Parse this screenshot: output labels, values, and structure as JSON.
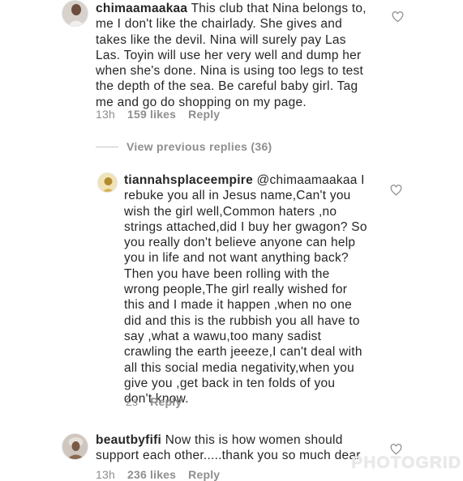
{
  "comments": [
    {
      "username": "chimaamaakaa",
      "text": "This club that Nina belongs to,\nme I don't like the chairlady. She gives and\ntakes like the devil. Nina will surely pay Las\nLas. Toyin will use her very well and dump her\nwhen she's done. Nina is using too legs to test\nthe depth of the sea. Be careful baby girl. Tag\nme and go do shopping on my page.",
      "time": "13h",
      "likes": "159 likes",
      "reply": "Reply"
    },
    {
      "username": "tiannahsplaceempire",
      "text": "@chimaamaakaa I\nrebuke you all in Jesus name,Can't you\nwish the girl well,Common haters ,no\nstrings attached,did I buy her gwagon? So\nyou really don't believe anyone can help\nyou in life and not want anything back?\nThen you have been rolling with the\nwrong people,The girl really wished for\nthis and I made it happen ,when no one\ndid and this is the rubbish you all have to\nsay ,what a wawu,too many sadist\ncrawling the earth jeeeze,I can't deal with\nall this social media negativity,when you\ngive you ,get back in ten folds of you\ndon't know.",
      "time": "2s",
      "reply": "Reply"
    },
    {
      "username": "beautbyfifi",
      "text": "Now this is how women should\nsupport each other.....thank you so much dear",
      "time": "13h",
      "likes": "236 likes",
      "reply": "Reply"
    }
  ],
  "view_previous": "View previous replies (36)",
  "watermark": "PHOTOGRID",
  "icons": {
    "like": "heart-outline-icon"
  },
  "colors": {
    "text": "#262626",
    "meta": "#8e8e8e"
  }
}
